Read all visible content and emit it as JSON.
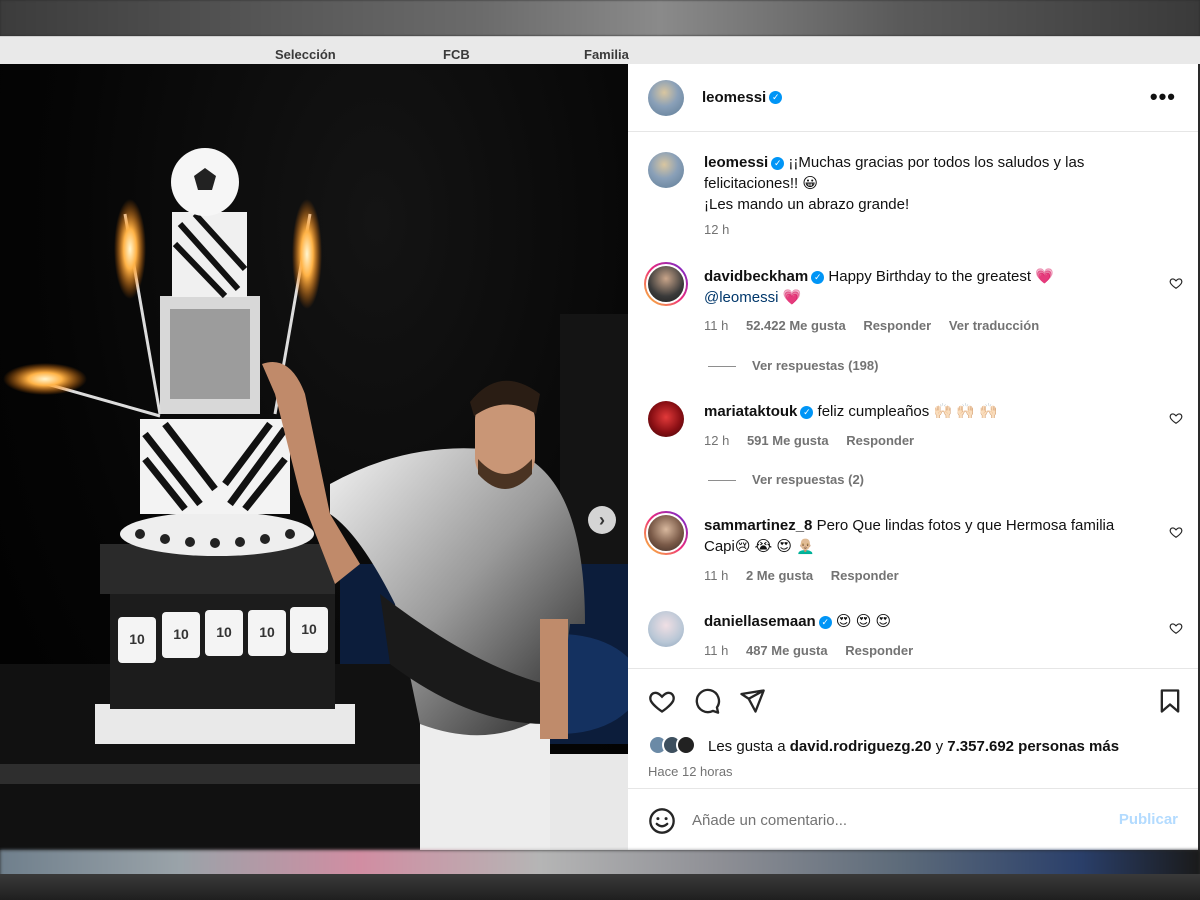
{
  "nav_tabs": [
    "Selección",
    "FCB",
    "Familia"
  ],
  "post": {
    "author": "leomessi",
    "caption_line1": "¡¡Muchas gracias por todos los saludos y las",
    "caption_line2": "felicitaciones!! 😀",
    "caption_line3": "¡Les mando un abrazo grande!",
    "caption_time": "12 h",
    "jersey_number": "10"
  },
  "comments": [
    {
      "user": "davidbeckham",
      "text": "Happy Birthday to the greatest 💗",
      "mention": "@leomessi",
      "mention_suffix": " 💗",
      "time": "11 h",
      "likes": "52.422 Me gusta",
      "reply": "Responder",
      "translate": "Ver traducción",
      "view_replies": "Ver respuestas (198)"
    },
    {
      "user": "mariataktouk",
      "text": "feliz cumpleaños 🙌🏻 🙌🏻 🙌🏻",
      "time": "12 h",
      "likes": "591 Me gusta",
      "reply": "Responder",
      "view_replies": "Ver respuestas (2)"
    },
    {
      "user": "sammartinez_8",
      "text": "Pero Que lindas fotos y que Hermosa familia",
      "text2": "Capi😢 😭 😍 👨🏼‍🦲",
      "time": "11 h",
      "likes": "2 Me gusta",
      "reply": "Responder"
    },
    {
      "user": "daniellasemaan",
      "text": "😍 😍 😍",
      "time": "11 h",
      "likes": "487 Me gusta",
      "reply": "Responder"
    }
  ],
  "likes": {
    "prefix": "Les gusta a ",
    "first_user": "david.rodriguezg.20",
    "middle": " y ",
    "others": "7.357.692 personas más"
  },
  "posted_ago": "Hace 12 horas",
  "comment_input": {
    "placeholder": "Añade un comentario...",
    "value": ""
  },
  "publish_label": "Publicar",
  "carousel": {
    "slides": 4,
    "active": 1
  },
  "icons": {
    "more": "more-options-icon",
    "like": "heart-icon",
    "comment": "comment-bubble-icon",
    "share": "paper-plane-icon",
    "save": "bookmark-icon",
    "emoji": "smiley-icon",
    "next": "chevron-right-icon"
  },
  "colors": {
    "verified": "#0095f6",
    "mention": "#00376b",
    "muted": "#737373",
    "publish_disabled": "#b3dbff"
  }
}
